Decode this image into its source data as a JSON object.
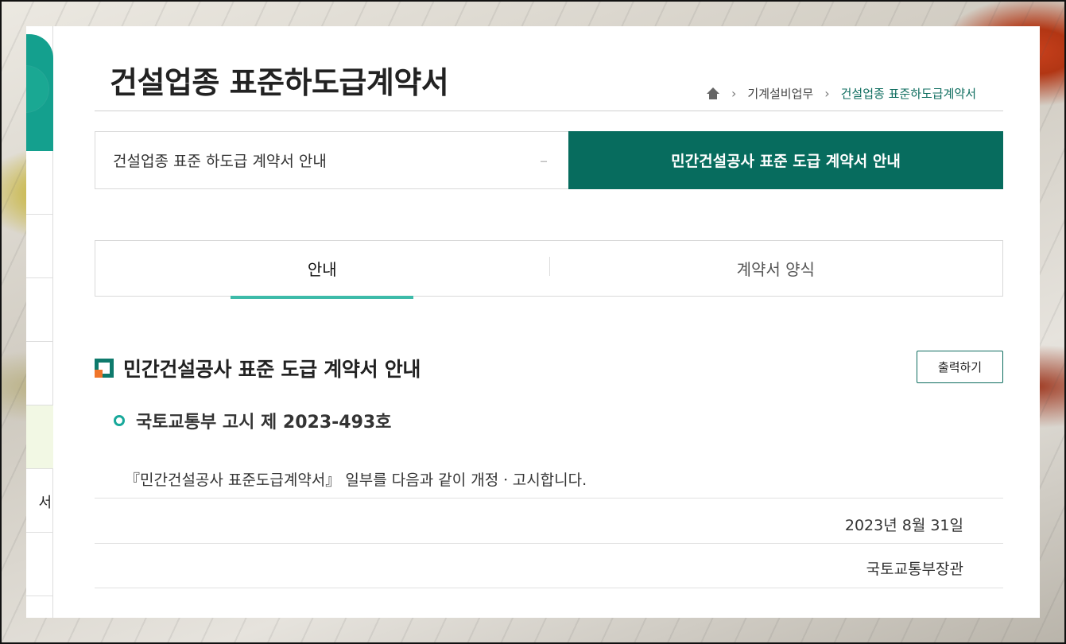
{
  "page": {
    "title": "건설업종 표준하도급계약서"
  },
  "breadcrumb": {
    "home_icon": "home-icon",
    "items": [
      "기계설비업무",
      "건설업종 표준하도급계약서"
    ]
  },
  "sidebar": {
    "visible_text": "서"
  },
  "main_tabs": [
    {
      "label": "건설업종 표준 하도급 계약서 안내",
      "indicator": "–",
      "active": false
    },
    {
      "label": "민간건설공사 표준 도급 계약서 안내",
      "active": true
    }
  ],
  "sub_tabs": [
    {
      "label": "안내",
      "active": true
    },
    {
      "label": "계약서 양식",
      "active": false
    }
  ],
  "section": {
    "title": "민간건설공사 표준 도급 계약서 안내",
    "print_label": "출력하기"
  },
  "notice": {
    "heading": "국토교통부 고시 제 2023-493호",
    "body": "『민간건설공사 표준도급계약서』 일부를 다음과 같이 개정ㆍ고시합니다.",
    "date": "2023년 8월 31일",
    "issuer": "국토교통부장관"
  },
  "colors": {
    "brand_dark_green": "#076c5e",
    "accent_teal": "#3dbba9",
    "accent_orange": "#f0752a"
  }
}
